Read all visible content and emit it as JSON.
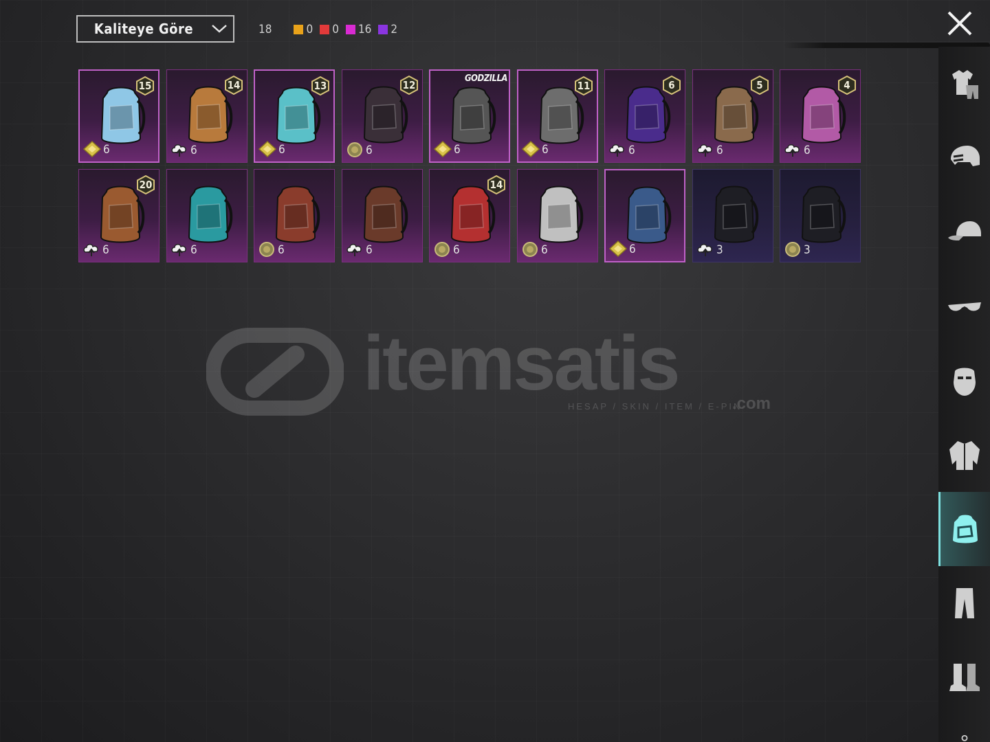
{
  "toolbar": {
    "sort_label": "Kaliteye Göre",
    "total_count": "18",
    "rarity_counts": [
      {
        "color": "#e8a21a",
        "count": "0"
      },
      {
        "color": "#e23a3a",
        "count": "0"
      },
      {
        "color": "#d92bd2",
        "count": "16"
      },
      {
        "color": "#8a35e0",
        "count": "2"
      }
    ]
  },
  "items": [
    {
      "level": "15",
      "count": "6",
      "badge": "gold-diamond",
      "tint": "#8fc7e6",
      "selected": true
    },
    {
      "level": "14",
      "count": "6",
      "badge": "upgrade-cloud",
      "tint": "#b87a3c",
      "selected": false
    },
    {
      "level": "13",
      "count": "6",
      "badge": "gold-diamond",
      "tint": "#5ac0c8",
      "selected": true
    },
    {
      "level": "12",
      "count": "6",
      "badge": "gold-coin",
      "tint": "#3a2f38",
      "selected": false
    },
    {
      "level": "",
      "brand": "GODZILLA",
      "count": "6",
      "badge": "gold-diamond",
      "tint": "#555555",
      "selected": true
    },
    {
      "level": "11",
      "count": "6",
      "badge": "gold-diamond",
      "tint": "#6d6d6d",
      "selected": true
    },
    {
      "level": "6",
      "count": "6",
      "badge": "upgrade-cloud",
      "tint": "#4a2c8c",
      "selected": false
    },
    {
      "level": "5",
      "count": "6",
      "badge": "upgrade-cloud",
      "tint": "#8a6a4c",
      "selected": false
    },
    {
      "level": "4",
      "count": "6",
      "badge": "upgrade-cloud",
      "tint": "#b25aa6",
      "selected": false
    },
    {
      "level": "20",
      "count": "6",
      "badge": "upgrade-cloud",
      "tint": "#9a5a30",
      "selected": false
    },
    {
      "level": "",
      "count": "6",
      "badge": "upgrade-cloud",
      "tint": "#2a9aa0",
      "selected": false
    },
    {
      "level": "",
      "count": "6",
      "badge": "gold-coin",
      "tint": "#8a3c2c",
      "selected": false
    },
    {
      "level": "",
      "count": "6",
      "badge": "upgrade-cloud",
      "tint": "#6a3a2a",
      "selected": false
    },
    {
      "level": "14",
      "count": "6",
      "badge": "gold-coin",
      "tint": "#b43030",
      "selected": false
    },
    {
      "level": "",
      "count": "6",
      "badge": "gold-coin",
      "tint": "#c0c0c0",
      "selected": false
    },
    {
      "level": "",
      "count": "6",
      "badge": "gold-diamond",
      "tint": "#3a5a8a",
      "selected": true
    },
    {
      "level": "",
      "count": "3",
      "badge": "upgrade-cloud",
      "tint": "#1e1e24",
      "selected": false,
      "dark": true
    },
    {
      "level": "",
      "count": "3",
      "badge": "gold-coin",
      "tint": "#1e1e24",
      "selected": false,
      "dark": true
    }
  ],
  "watermark": {
    "brand": "itemsatis",
    "tagline": "HESAP / SKIN / ITEM / E-PIN",
    "suffix": ".com"
  },
  "sidebar": [
    {
      "icon": "outfit-icon",
      "active": false
    },
    {
      "icon": "helmet-icon",
      "active": false
    },
    {
      "icon": "cap-icon",
      "active": false
    },
    {
      "icon": "glasses-icon",
      "active": false
    },
    {
      "icon": "mask-icon",
      "active": false
    },
    {
      "icon": "jacket-icon",
      "active": false
    },
    {
      "icon": "backpack-icon",
      "active": true
    },
    {
      "icon": "pants-icon",
      "active": false
    },
    {
      "icon": "boots-icon",
      "active": false
    }
  ]
}
